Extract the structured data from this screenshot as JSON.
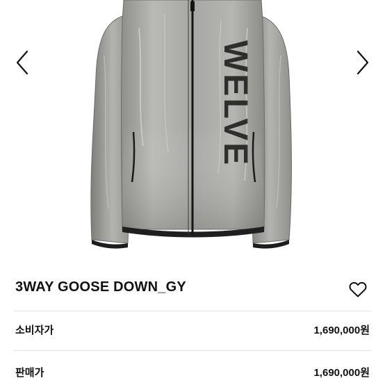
{
  "gallery": {
    "image_label": "WELVE",
    "prev_icon": "chevron-left-icon",
    "next_icon": "chevron-right-icon"
  },
  "product": {
    "title": "3WAY GOOSE DOWN_GY",
    "wishlist_icon": "heart-outline-icon"
  },
  "prices": [
    {
      "label": "소비자가",
      "value": "1,690,000원"
    },
    {
      "label": "판매가",
      "value": "1,690,000원"
    }
  ]
}
